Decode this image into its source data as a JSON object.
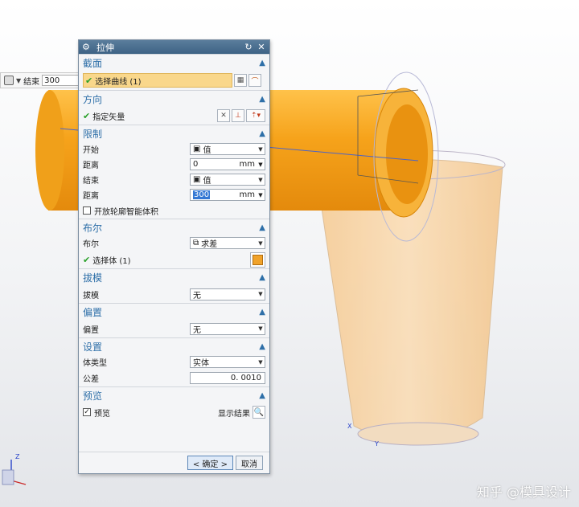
{
  "mini_toolbar": {
    "end_label": "结束",
    "end_value": "300"
  },
  "dialog": {
    "title": "拉伸",
    "sections": {
      "section": {
        "title": "截面",
        "select_curve": "选择曲线 (1)"
      },
      "direction": {
        "title": "方向",
        "vector_label": "指定矢量"
      },
      "limits": {
        "title": "限制",
        "start_label": "开始",
        "start_value": "值",
        "distance1_label": "距离",
        "distance1_value": "0",
        "distance1_unit": "mm",
        "end_label": "结束",
        "end_value": "值",
        "distance2_label": "距离",
        "distance2_value": "300",
        "distance2_unit": "mm",
        "open_profile_label": "开放轮廓智能体积"
      },
      "boolean": {
        "title": "布尔",
        "boolean_label": "布尔",
        "boolean_value": "求差",
        "select_body": "选择体 (1)"
      },
      "draft": {
        "title": "拔模",
        "draft_label": "拔模",
        "draft_value": "无"
      },
      "offset": {
        "title": "偏置",
        "offset_label": "偏置",
        "offset_value": "无"
      },
      "settings": {
        "title": "设置",
        "body_type_label": "体类型",
        "body_type_value": "实体",
        "tolerance_label": "公差",
        "tolerance_value": "0. 0010"
      },
      "preview": {
        "title": "预览",
        "preview_label": "预览",
        "show_result_label": "显示结果"
      }
    },
    "ok_label": "< 确定 >",
    "cancel_label": "取消"
  },
  "watermark": "知乎 @模具设计",
  "axes": {
    "x": "X",
    "y": "Y",
    "z": "Z"
  },
  "colors": {
    "accent": "#2e6fa8",
    "body_fill": "#f4a018",
    "selection": "#f9d78b",
    "check": "#2aa12a"
  }
}
